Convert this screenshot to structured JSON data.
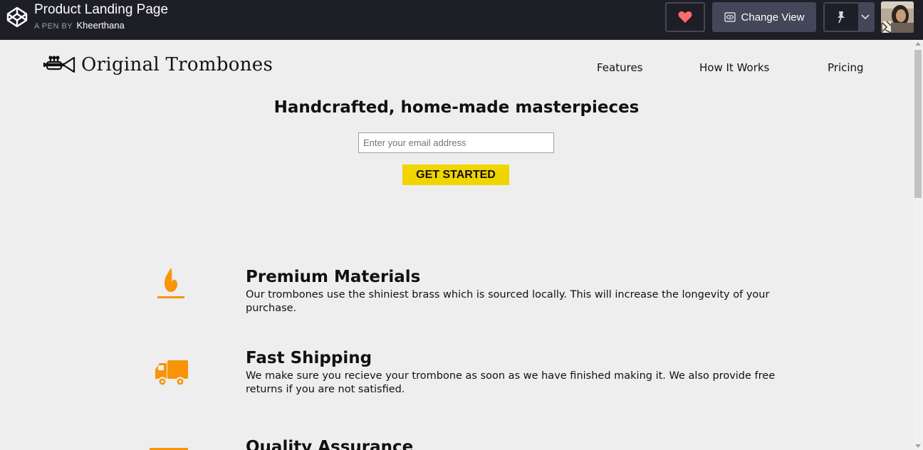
{
  "topbar": {
    "pen_title": "Product Landing Page",
    "pen_by_label": "A PEN BY",
    "author": "Kheerthana",
    "change_view_label": "Change View",
    "heart_color": "#ff5a5a"
  },
  "header": {
    "brand_name": "Original Trombones",
    "nav": [
      "Features",
      "How It Works",
      "Pricing"
    ]
  },
  "hero": {
    "headline": "Handcrafted, home-made masterpieces",
    "email_placeholder": "Enter your email address",
    "cta_label": "GET STARTED",
    "cta_color": "#f0d500"
  },
  "features": [
    {
      "icon": "flame-icon",
      "title": "Premium Materials",
      "text": "Our trombones use the shiniest brass which is sourced locally. This will increase the longevity of your purchase."
    },
    {
      "icon": "truck-icon",
      "title": "Fast Shipping",
      "text": "We make sure you recieve your trombone as soon as we have finished making it. We also provide free returns if you are not satisfied."
    },
    {
      "icon": "battery-icon",
      "title": "Quality Assurance",
      "text": ""
    }
  ],
  "accent_color": "#f89406"
}
